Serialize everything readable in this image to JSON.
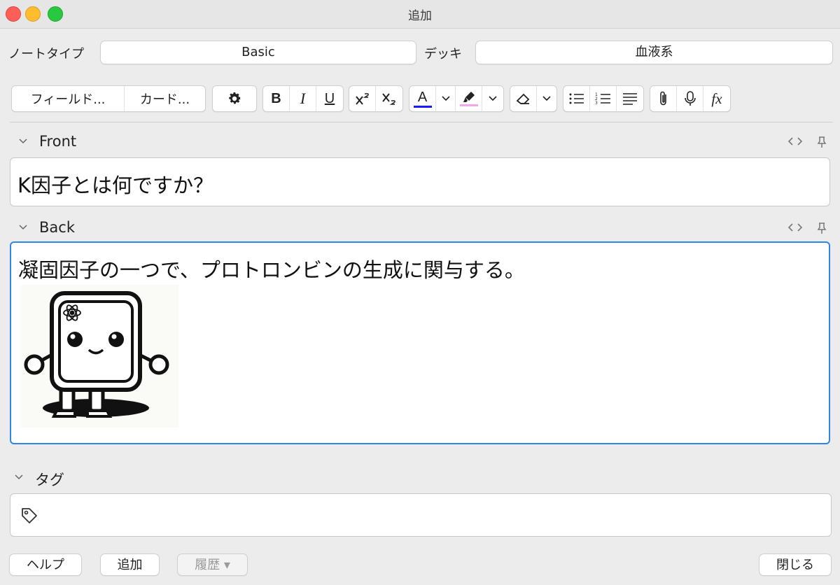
{
  "window": {
    "title": "追加"
  },
  "top": {
    "notetype_label": "ノートタイプ",
    "notetype_value": "Basic",
    "deck_label": "デッキ",
    "deck_value": "血液系"
  },
  "toolbar": {
    "fields_button": "フィールド...",
    "cards_button": "カード...",
    "bold": "B",
    "italic": "I",
    "underline": "U",
    "text_color_glyph": "A",
    "text_color": "#1a1aff",
    "highlight_color": "#f0a8e8",
    "math_glyph": "fx"
  },
  "fields": [
    {
      "name": "Front",
      "content": "K因子とは何ですか？"
    },
    {
      "name": "Back",
      "content": "凝固因子の一つで、プロトロンビンの生成に関与する。"
    }
  ],
  "tags": {
    "label": "タグ"
  },
  "bottom": {
    "help": "ヘルプ",
    "add": "追加",
    "history": "履歴 ▾",
    "close": "閉じる"
  },
  "colors": {
    "focus_border": "#2f86e6"
  }
}
